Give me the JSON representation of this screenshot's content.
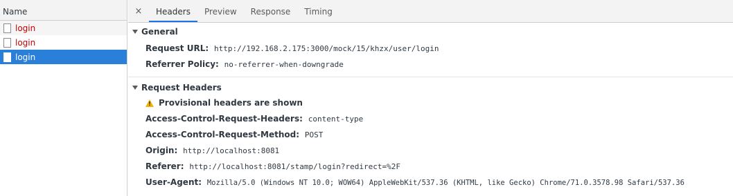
{
  "request_list": {
    "column_header": "Name",
    "items": [
      {
        "name": "login",
        "selected": false
      },
      {
        "name": "login",
        "selected": false
      },
      {
        "name": "login",
        "selected": true
      }
    ]
  },
  "detail": {
    "close_label": "×",
    "tabs": [
      "Headers",
      "Preview",
      "Response",
      "Timing"
    ],
    "active_tab": "Headers",
    "general": {
      "title": "General",
      "request_url_key": "Request URL:",
      "request_url_value": "http://192.168.2.175:3000/mock/15/khzx/user/login",
      "referrer_policy_key": "Referrer Policy:",
      "referrer_policy_value": "no-referrer-when-downgrade"
    },
    "request_headers": {
      "title": "Request Headers",
      "warning": "Provisional headers are shown",
      "rows": [
        {
          "key": "Access-Control-Request-Headers:",
          "value": "content-type"
        },
        {
          "key": "Access-Control-Request-Method:",
          "value": "POST"
        },
        {
          "key": "Origin:",
          "value": "http://localhost:8081"
        },
        {
          "key": "Referer:",
          "value": "http://localhost:8081/stamp/login?redirect=%2F"
        },
        {
          "key": "User-Agent:",
          "value": "Mozilla/5.0 (Windows NT 10.0; WOW64) AppleWebKit/537.36 (KHTML, like Gecko) Chrome/71.0.3578.98 Safari/537.36"
        }
      ]
    }
  },
  "colors": {
    "error_text": "#c80000",
    "selected_row": "#2a7fd8",
    "active_tab_underline": "#1a73e8",
    "warning": "#f2b400"
  }
}
